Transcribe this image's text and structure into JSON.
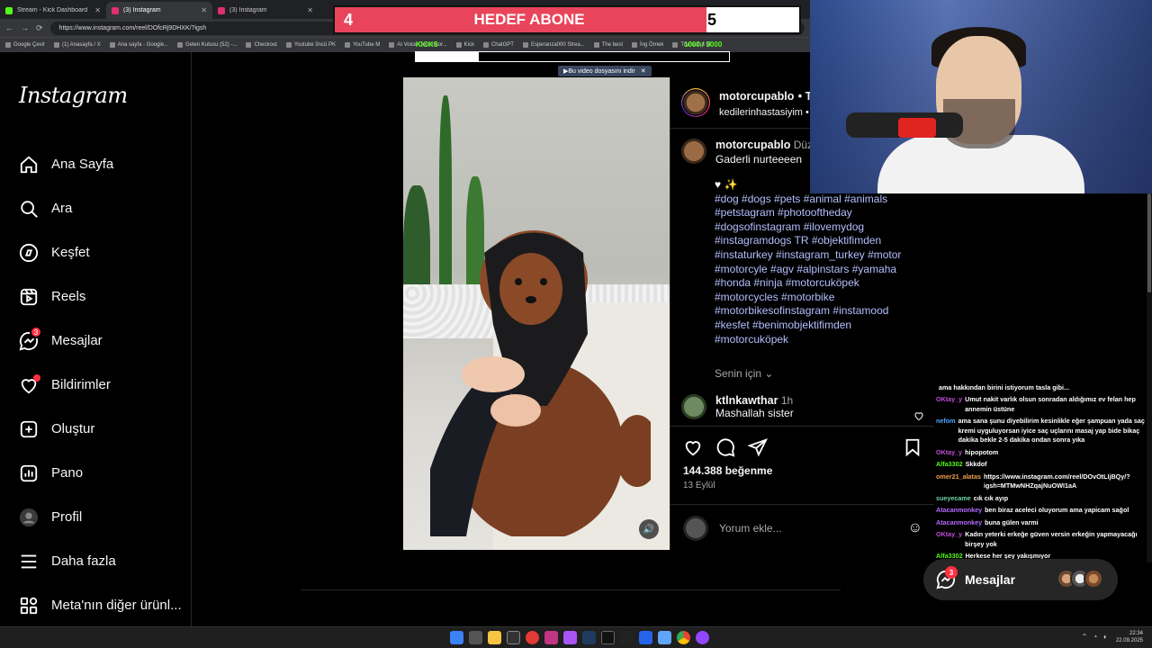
{
  "browser": {
    "tabs": [
      {
        "title": "Stream - Kick Dashboard",
        "color": "#53fc18",
        "active": false
      },
      {
        "title": "(3) Instagram",
        "color": "#e1306c",
        "active": true
      },
      {
        "title": "(3) Instagram",
        "color": "#e1306c",
        "active": false
      }
    ],
    "url": "https://www.instagram.com/reel/DOfcRj9DHXK/?igsh",
    "bookmarks": [
      "Google Çevir",
      "(1) Anasayfa / X",
      "Ana sayfa - Google...",
      "Gelen Kutusu (52) -...",
      "Checkout",
      "Youtube 3ncü PK",
      "YouTube M",
      "AI Voice Generator...",
      "Kick",
      "ChatGPT",
      "Esperanza000 Strea...",
      "The best",
      "İng Örnek",
      "Transcript of"
    ]
  },
  "instagram": {
    "logo": "Instagram",
    "nav": [
      {
        "label": "Ana Sayfa",
        "icon": "home-icon"
      },
      {
        "label": "Ara",
        "icon": "search-icon"
      },
      {
        "label": "Keşfet",
        "icon": "compass-icon"
      },
      {
        "label": "Reels",
        "icon": "reels-icon"
      },
      {
        "label": "Mesajlar",
        "icon": "messenger-icon",
        "badge": "3"
      },
      {
        "label": "Bildirimler",
        "icon": "heart-icon",
        "dot": true
      },
      {
        "label": "Oluştur",
        "icon": "plus-square-icon"
      },
      {
        "label": "Pano",
        "icon": "dashboard-icon"
      },
      {
        "label": "Profil",
        "icon": "profile-avatar"
      },
      {
        "label": "Daha fazla",
        "icon": "menu-icon"
      },
      {
        "label": "Meta'nın diğer ürünl...",
        "icon": "apps-icon"
      }
    ],
    "post": {
      "author": "motorcupablo",
      "header_suffix": "• Ta",
      "header_sub": "kedilerinhastasiyim • C",
      "caption_author": "motorcupablo",
      "caption_suffix": "Düze",
      "caption_text": "Gaderli nurteeeen",
      "emoji_line": "♥ ✨",
      "hashtags": "#dog #dogs #pets #animal #animals #petstagram #photooftheday #dogsofinstagram #ilovemydog #instagramdogs TR #objektifimden #instaturkey #instagram_turkey #motor #motorcyle #agv #alpinstars #yamaha #honda #ninja #motorcuköpek #motorcycles #motorbike #motorbikesofinstagram #instamood #kesfet #benimobjektifimden #motorcuköpek",
      "for_you": "Senin için",
      "comment_user": "ktlnkawthar",
      "comment_time": "1h",
      "comment_text": "Mashallah sister",
      "likes": "144.388 beğenme",
      "date": "13 Eylül",
      "add_comment_placeholder": "Yorum ekle..."
    },
    "messages_button": {
      "label": "Mesajlar",
      "badge": "3"
    }
  },
  "stream": {
    "goal": {
      "start": "4",
      "label": "HEDEF ABONE",
      "end": "5",
      "progress": 0.8,
      "color": "#e8455b"
    },
    "kicks_label": "KICKS",
    "kicks_count": "1000 / 5000",
    "kicks_progress": 0.2,
    "download_bar": "Bu video dosyasını indir",
    "chat": [
      {
        "user": "",
        "text": "ama hakkından birini istiyorum tasla gibi..."
      },
      {
        "user": "OKtay_y",
        "color": "#c24bd6",
        "text": "Umut nakit varlık olsun sonradan aldığımız ev felan hep annemin üstüne"
      },
      {
        "user": "nefom",
        "color": "#4da3ff",
        "text": "ama sana şunu diyebilirim kesinlikle eğer şampuan yada saç kremi uyguluyorsan iyice saç uçlarını masaj yap bide bikaç dakika bekle 2-5 dakika ondan sonra yıka"
      },
      {
        "user": "OKtay_y",
        "color": "#c24bd6",
        "text": "hipopotom"
      },
      {
        "user": "Alfa3302",
        "color": "#53fc18",
        "text": "Skkdof"
      },
      {
        "user": "omer21_alatas",
        "color": "#f0a04b",
        "text": "https://www.instagram.com/reel/DOvOtLIjBQy/?igsh=MTMwNHZqajNuOWI1aA"
      },
      {
        "user": "sueyecame",
        "color": "#6bd3a3",
        "text": "cık cık ayıp"
      },
      {
        "user": "Atacanmonkey",
        "color": "#b46bff",
        "text": "ben biraz aceleci oluyorum ama yapicam sağol"
      },
      {
        "user": "Atacanmonkey",
        "color": "#b46bff",
        "text": "buna gülen varmi"
      },
      {
        "user": "OKtay_y",
        "color": "#c24bd6",
        "text": "Kadın yeterki erkeğe güven versin erkeğin yapmayacağı birşey yok"
      },
      {
        "user": "Alfa3302",
        "color": "#53fc18",
        "text": "Herkese her şey yakışmıyor"
      }
    ]
  },
  "taskbar": {
    "time": "22:34",
    "date": "22.09.2025"
  }
}
